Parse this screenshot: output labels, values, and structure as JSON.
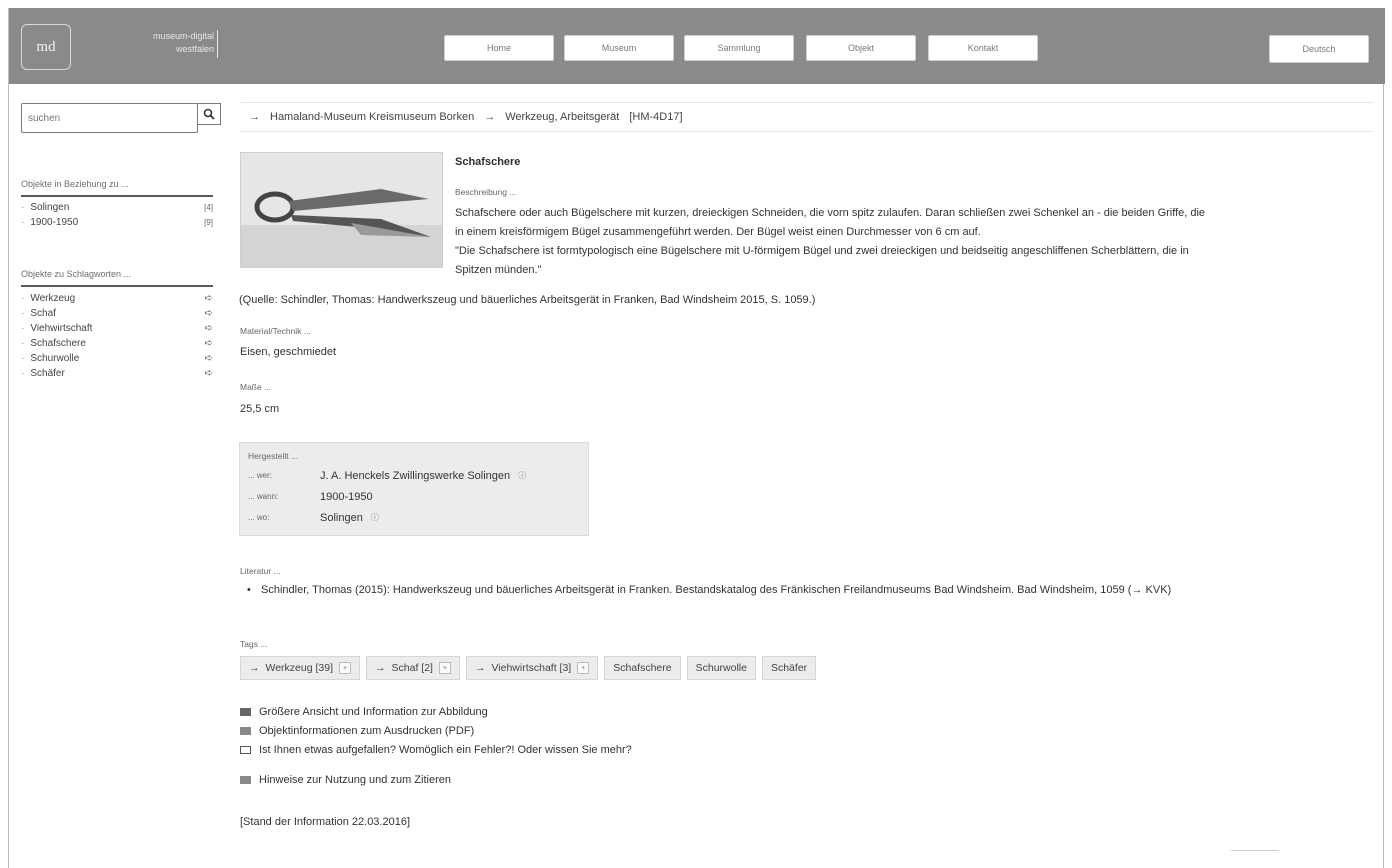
{
  "header": {
    "logo": "md",
    "brand_line1": "museum-digital",
    "brand_line2": "westfalen",
    "nav": [
      "Home",
      "Museum",
      "Sammlung",
      "Objekt",
      "Kontakt"
    ],
    "language": "Deutsch"
  },
  "sidebar": {
    "search_placeholder": "suchen",
    "related_heading": "Objekte in Beziehung zu ...",
    "related": [
      {
        "label": "Solingen",
        "count": "[4]"
      },
      {
        "label": "1900-1950",
        "count": "[9]"
      }
    ],
    "keywords_heading": "Objekte zu Schlagworten ...",
    "keywords": [
      "Werkzeug",
      "Schaf",
      "Viehwirtschaft",
      "Schafschere",
      "Schurwolle",
      "Schäfer"
    ]
  },
  "breadcrumb": {
    "museum": "Hamaland-Museum Kreismuseum Borken",
    "collection": "Werkzeug, Arbeitsgerät",
    "inventory": "[HM-4D17]"
  },
  "object": {
    "title": "Schafschere",
    "description_label": "Beschreibung ...",
    "description_lines": [
      "Schafschere oder auch Bügelschere mit kurzen, dreieckigen Schneiden, die vorn spitz zulaufen. Daran schließen zwei Schenkel an - die beiden Griffe, die",
      "in einem kreisförmigem Bügel zusammengeführt werden. Der Bügel weist einen Durchmesser von 6 cm auf.",
      "\"Die Schafschere ist formtypologisch eine Bügelschere mit U-förmigem Bügel und zwei dreieckigen und beidseitig angeschliffenen Scherblättern, die in",
      "Spitzen münden.\""
    ],
    "source": "(Quelle: Schindler, Thomas: Handwerkszeug und bäuerliches Arbeitsgerät in Franken, Bad Windsheim 2015, S. 1059.)",
    "material_label": "Material/Technik ...",
    "material": "Eisen, geschmiedet",
    "measure_label": "Maße ...",
    "measure": "25,5 cm",
    "made": {
      "heading": "Hergestellt ...",
      "who_key": "... wer:",
      "who": "J. A. Henckels Zwillingswerke Solingen",
      "when_key": "... wann:",
      "when": "1900-1950",
      "where_key": "... wo:",
      "where": "Solingen"
    },
    "literature_label": "Literatur ...",
    "literature": "Schindler, Thomas (2015): Handwerkszeug und bäuerliches Arbeitsgerät in Franken. Bestandskatalog des Fränkischen Freilandmuseums Bad Windsheim. Bad Windsheim, 1059 (→ KVK)",
    "tags_label": "Tags ...",
    "tags_linked": [
      "Werkzeug [39]",
      "Schaf [2]",
      "Viehwirtschaft [3]"
    ],
    "tags_plain": [
      "Schafschere",
      "Schurwolle",
      "Schäfer"
    ],
    "links": [
      "Größere Ansicht und Information zur Abbildung",
      "Objektinformationen zum Ausdrucken (PDF)",
      "Ist Ihnen etwas aufgefallen? Womöglich ein Fehler?! Oder wissen Sie mehr?"
    ],
    "usage": "Hinweise zur Nutzung und zum Zitieren",
    "stand": "[Stand der Information 22.03.2016]"
  }
}
